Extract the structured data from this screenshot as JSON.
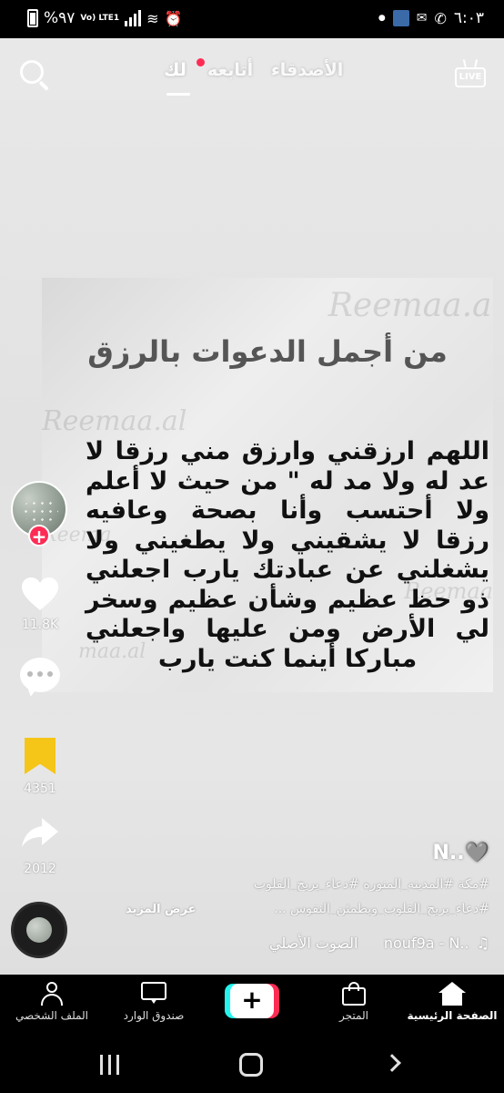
{
  "status_bar": {
    "time": "٦:٠٣",
    "battery": "%٩٧",
    "network": "Vo) LTE1"
  },
  "top_nav": {
    "tabs": [
      {
        "label": "لك",
        "active": true
      },
      {
        "label": "أتابعه",
        "has_dot": true
      },
      {
        "label": "الأصدقاء"
      }
    ],
    "live_label": "LIVE"
  },
  "video": {
    "title": "من أجمل الدعوات بالرزق",
    "body": "اللهم ارزقني وارزق مني رزقا لا عد له ولا مد له \" من حيث لا أعلم ولا أحتسب وأنا بصحة وعافيه رزقا لا يشقيني ولا يطغيني ولا يشغلني عن عبادتك يارب اجعلني ذو حظ عظيم وشأن عظيم وسخر لي الأرض ومن عليها واجعلني مباركا أينما كنت يارب",
    "watermark": "Reemaa.al"
  },
  "side_actions": {
    "likes": "11.8K",
    "bookmarks": "4351",
    "shares": "2012"
  },
  "caption": {
    "author": "N..🩶",
    "hashtags_line1": "#مكة #المدينه_المنوره #دعاء_يريح_القلوب",
    "hashtags_line2": "#دعاء_يريح_القلوب_ويطمئن_النفوس ...",
    "see_more": "عرض المزيد",
    "music_user": "nouf9a - N..",
    "music_sound": "الصوت الأصلي"
  },
  "bottom_nav": {
    "home": "الصفحة الرئيسية",
    "shop": "المتجر",
    "inbox": "صندوق الوارد",
    "profile": "الملف الشخصي"
  },
  "colors": {
    "accent": "#fe2c55",
    "cyan": "#25f4ee",
    "bookmark": "#f5c518"
  }
}
